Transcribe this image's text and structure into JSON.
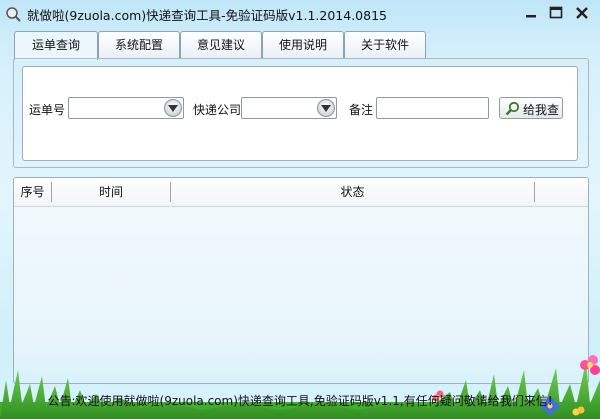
{
  "window": {
    "title": "就做啦(9zuola.com)快递查询工具-免验证码版v1.1.2014.0815",
    "icons": [
      "app-icon",
      "minimize-icon",
      "maximize-icon",
      "close-icon"
    ]
  },
  "tabs": [
    {
      "label": "运单查询",
      "active": true
    },
    {
      "label": "系统配置",
      "active": false
    },
    {
      "label": "意见建议",
      "active": false
    },
    {
      "label": "使用说明",
      "active": false
    },
    {
      "label": "关于软件",
      "active": false
    }
  ],
  "query": {
    "waybill_label": "运单号",
    "waybill_value": "",
    "company_label": "快递公司",
    "company_value": "",
    "remark_label": "备注",
    "remark_value": "",
    "search_button": "给我查"
  },
  "results": {
    "columns": [
      "序号",
      "时间",
      "状态"
    ],
    "rows": []
  },
  "footer": {
    "notice": "公告:欢迎使用就做啦(9zuola.com)快递查询工具,免验证码版v1.1,有任何疑问敬请给我们来信!"
  },
  "colors": {
    "background": "#d6f0fb",
    "panel_border": "#9fb1bd",
    "grass": "#3fae2a"
  }
}
